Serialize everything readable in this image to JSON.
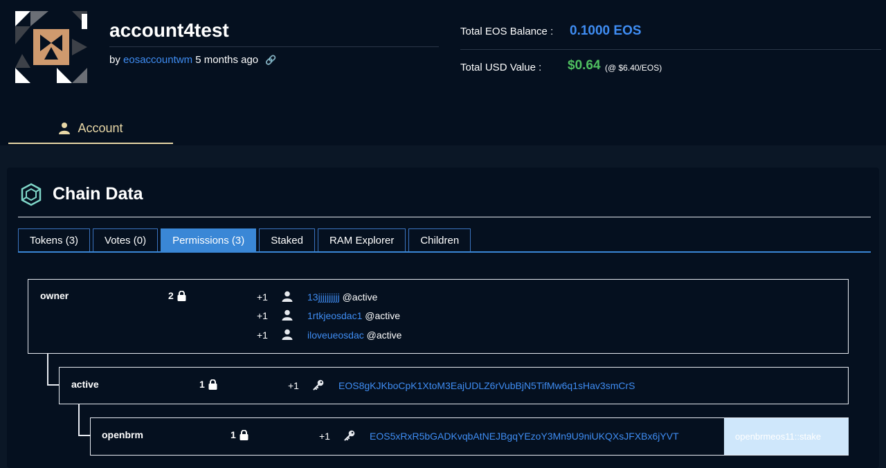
{
  "account": {
    "name": "account4test",
    "by_prefix": "by",
    "creator": "eosaccountwm",
    "age": "5 months ago"
  },
  "balance": {
    "eos_label": "Total EOS Balance :",
    "eos_value": "0.1000 EOS",
    "usd_label": "Total USD Value :",
    "usd_value": "$0.64",
    "usd_rate": "(@ $6.40/EOS)"
  },
  "nav": {
    "account_tab": "Account"
  },
  "chain": {
    "title": "Chain Data",
    "tabs": [
      {
        "label": "Tokens (3)"
      },
      {
        "label": "Votes (0)"
      },
      {
        "label": "Permissions (3)"
      },
      {
        "label": "Staked"
      },
      {
        "label": "RAM Explorer"
      },
      {
        "label": "Children"
      }
    ],
    "active_tab": "Permissions (3)"
  },
  "permissions": {
    "owner": {
      "name": "owner",
      "threshold": "2",
      "entries": [
        {
          "weight": "+1",
          "account": "13jjjjjjjjjj",
          "perm": "@active"
        },
        {
          "weight": "+1",
          "account": "1rtkjeosdac1",
          "perm": "@active"
        },
        {
          "weight": "+1",
          "account": "iloveueosdac",
          "perm": "@active"
        }
      ]
    },
    "active": {
      "name": "active",
      "threshold": "1",
      "weight": "+1",
      "key": "EOS8gKJKboCpK1XtoM3EajUDLZ6rVubBjN5TifMw6q1sHav3smCrS"
    },
    "openbrm": {
      "name": "openbrm",
      "threshold": "1",
      "weight": "+1",
      "key": "EOS5xRxR5bGADKvqbAtNEJBgqYEzoY3Mn9U9niUKQXsJFXBx6jYVT",
      "link": "openbrmeos11::stake"
    }
  },
  "colors": {
    "background": "#05101f",
    "link_blue": "#3f8df3",
    "usd_green": "#4fc060",
    "gold": "#e8d7a6",
    "tab_active": "#3a87d6"
  }
}
